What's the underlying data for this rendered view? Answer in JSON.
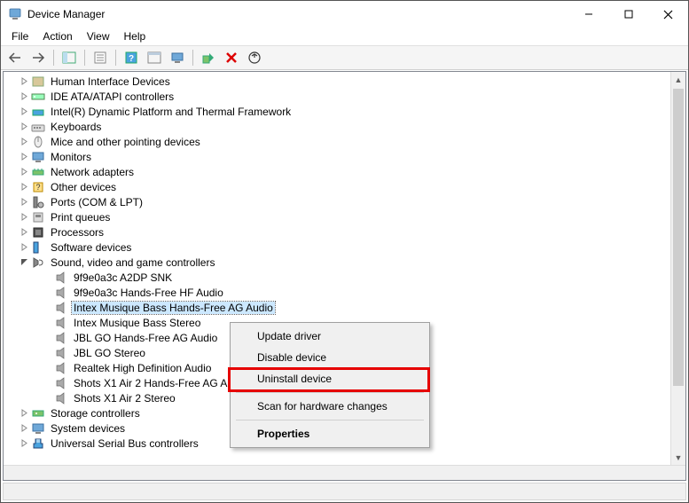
{
  "window": {
    "title": "Device Manager"
  },
  "menu": {
    "file": "File",
    "action": "Action",
    "view": "View",
    "help": "Help"
  },
  "tree": {
    "categories": [
      {
        "label": "Human Interface Devices",
        "expanded": false
      },
      {
        "label": "IDE ATA/ATAPI controllers",
        "expanded": false
      },
      {
        "label": "Intel(R) Dynamic Platform and Thermal Framework",
        "expanded": false
      },
      {
        "label": "Keyboards",
        "expanded": false
      },
      {
        "label": "Mice and other pointing devices",
        "expanded": false
      },
      {
        "label": "Monitors",
        "expanded": false
      },
      {
        "label": "Network adapters",
        "expanded": false
      },
      {
        "label": "Other devices",
        "expanded": false
      },
      {
        "label": "Ports (COM & LPT)",
        "expanded": false
      },
      {
        "label": "Print queues",
        "expanded": false
      },
      {
        "label": "Processors",
        "expanded": false
      },
      {
        "label": "Software devices",
        "expanded": false
      },
      {
        "label": "Sound, video and game controllers",
        "expanded": true
      },
      {
        "label": "Storage controllers",
        "expanded": false
      },
      {
        "label": "System devices",
        "expanded": false
      },
      {
        "label": "Universal Serial Bus controllers",
        "expanded": false
      }
    ],
    "sound_children": [
      {
        "label": "9f9e0a3c A2DP SNK",
        "selected": false
      },
      {
        "label": "9f9e0a3c Hands-Free HF Audio",
        "selected": false
      },
      {
        "label": "Intex Musique Bass Hands-Free AG Audio",
        "selected": true
      },
      {
        "label": "Intex Musique Bass Stereo",
        "selected": false
      },
      {
        "label": "JBL GO Hands-Free AG Audio",
        "selected": false
      },
      {
        "label": "JBL GO Stereo",
        "selected": false
      },
      {
        "label": "Realtek High Definition Audio",
        "selected": false
      },
      {
        "label": "Shots X1 Air 2 Hands-Free AG Audio",
        "selected": false
      },
      {
        "label": "Shots X1 Air 2 Stereo",
        "selected": false
      }
    ]
  },
  "context_menu": {
    "update": "Update driver",
    "disable": "Disable device",
    "uninstall": "Uninstall device",
    "scan": "Scan for hardware changes",
    "properties": "Properties"
  }
}
